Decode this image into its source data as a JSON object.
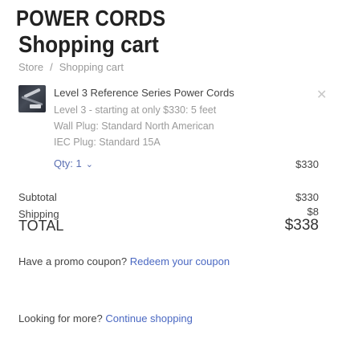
{
  "brand": "POWER CORDS",
  "page_title": "Shopping cart",
  "breadcrumb": {
    "home": "Store",
    "separator": "/",
    "current": "Shopping cart"
  },
  "cart_item": {
    "name": "Level 3 Reference Series Power Cords",
    "details": [
      "Level 3 - starting at only $330: 5 feet",
      "Wall Plug: Standard North American",
      "IEC Plug: Standard 15A"
    ],
    "qty_label": "Qty: 1",
    "price": "$330",
    "remove_icon": "close-icon"
  },
  "summary": {
    "subtotal_label": "Subtotal",
    "subtotal_value": "$330",
    "shipping_label": "Shipping",
    "shipping_value": "$8",
    "total_label": "TOTAL",
    "total_value": "$338"
  },
  "promo": {
    "text": "Have a promo coupon?",
    "link": "Redeem your coupon"
  },
  "more": {
    "text": "Looking for more?",
    "link": "Continue shopping"
  },
  "colors": {
    "link": "#4a68c2",
    "muted": "#9a9a9a",
    "text": "#444444"
  }
}
